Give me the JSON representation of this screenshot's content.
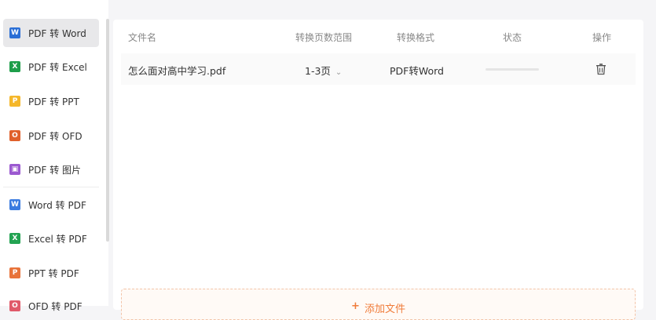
{
  "sidebar": {
    "items": [
      {
        "label": "PDF 转 Word",
        "icon": "word-icon",
        "icon_glyph": "W",
        "color": "#2b6fd6",
        "active": true
      },
      {
        "label": "PDF 转 Excel",
        "icon": "excel-icon",
        "icon_glyph": "X",
        "color": "#1e9e4a"
      },
      {
        "label": "PDF 转 PPT",
        "icon": "ppt-icon",
        "icon_glyph": "P",
        "color": "#f5b72a"
      },
      {
        "label": "PDF 转 OFD",
        "icon": "ofd-icon",
        "icon_glyph": "O",
        "color": "#e0602b"
      },
      {
        "label": "PDF 转 图片",
        "icon": "image-icon",
        "icon_glyph": "▣",
        "color": "#9b59d0"
      },
      {
        "label": "Word 转 PDF",
        "icon": "word-doc-icon",
        "icon_glyph": "W",
        "color": "#3a7be0"
      },
      {
        "label": "Excel 转 PDF",
        "icon": "excel-doc-icon",
        "icon_glyph": "X",
        "color": "#23a352"
      },
      {
        "label": "PPT 转 PDF",
        "icon": "ppt-doc-icon",
        "icon_glyph": "P",
        "color": "#e8733a"
      },
      {
        "label": "OFD 转 PDF",
        "icon": "ofd-doc-icon",
        "icon_glyph": "O",
        "color": "#e05a6a"
      }
    ]
  },
  "table": {
    "headers": {
      "filename": "文件名",
      "range": "转换页数范围",
      "format": "转换格式",
      "status": "状态",
      "action": "操作"
    },
    "rows": [
      {
        "filename": "怎么面对高中学习.pdf",
        "range": "1-3页",
        "format": "PDF转Word",
        "progress": 0
      }
    ]
  },
  "add_file": {
    "label": "添加文件",
    "icon": "plus-icon"
  },
  "colors": {
    "accent": "#f07c3a",
    "active_bg": "#e8e8ea"
  }
}
